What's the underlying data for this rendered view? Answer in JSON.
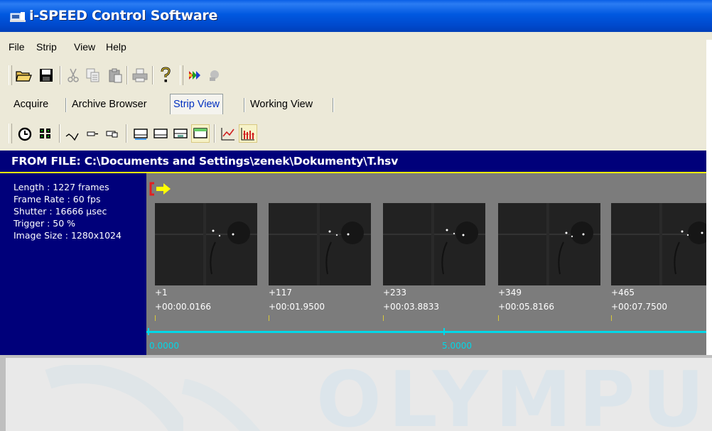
{
  "window": {
    "title": "i-SPEED Control Software"
  },
  "menu": {
    "items": [
      "File",
      "Strip",
      "View",
      "Help"
    ]
  },
  "toolbar_main": {
    "icons": [
      "open-folder-icon",
      "save-icon",
      "cut-icon",
      "copy-icon",
      "paste-icon",
      "print-icon",
      "help-icon",
      "color-arrow-icon",
      "disabled-icon"
    ]
  },
  "tabs": {
    "items": [
      "Acquire",
      "Archive Browser",
      "Strip View",
      "Working View"
    ],
    "active": "Strip View"
  },
  "toolbar_view": {
    "icons": [
      "clock-icon",
      "grid-icon",
      "waveform-icon",
      "zoom-out-icon",
      "zoom-in-icon",
      "layout-bottom-icon",
      "layout-top-icon",
      "layout-split-icon",
      "layout-active-icon",
      "line-chart-icon",
      "bar-chart-icon"
    ]
  },
  "file_header": {
    "text": "FROM FILE: C:\\Documents and Settings\\zenek\\Dokumenty\\T.hsv"
  },
  "info": {
    "length": "Length : 1227 frames",
    "frame_rate": "Frame Rate : 60 fps",
    "shutter": "Shutter : 16666 µsec",
    "trigger": "Trigger : 50 %",
    "image_size": "Image Size : 1280x1024"
  },
  "frames": [
    {
      "number": "+1",
      "time": "+00:00.0166"
    },
    {
      "number": "+117",
      "time": "+00:01.9500"
    },
    {
      "number": "+233",
      "time": "+00:03.8833"
    },
    {
      "number": "+349",
      "time": "+00:05.8166"
    },
    {
      "number": "+465",
      "time": "+00:07.7500"
    }
  ],
  "timeline": {
    "labels": [
      "0.0000",
      "5.0000"
    ]
  },
  "watermark": {
    "text": "OLYMPUS"
  },
  "colors": {
    "title_bar": "#0058e0",
    "header_bg": "#00007a",
    "accent_yellow": "#ffff00",
    "timeline_cyan": "#00d8e8"
  }
}
